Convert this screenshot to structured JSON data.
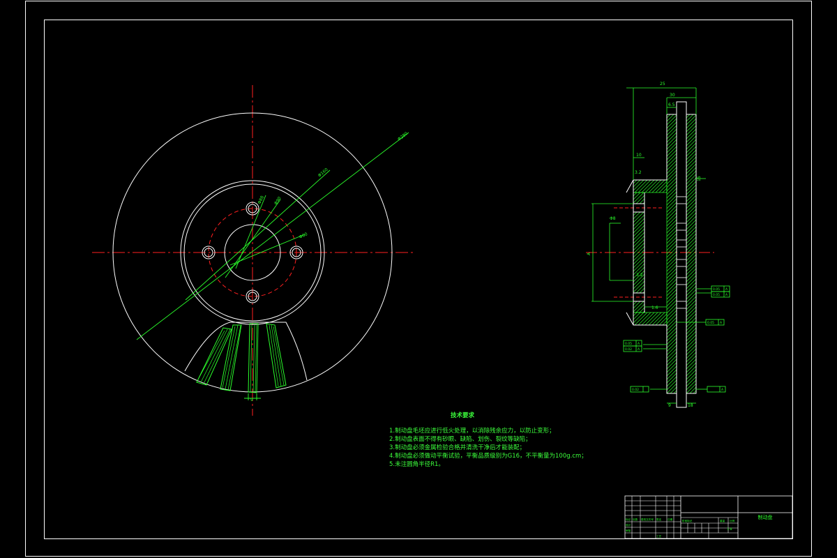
{
  "colors": {
    "background": "#000000",
    "frame": "#ffffff",
    "geometry": "#ffffff",
    "dimension": "#2bff2b",
    "centerline": "#ff2020",
    "hatch": "#2bff2b"
  },
  "front_view": {
    "dim_labels": [
      "Φ280",
      "Φ160",
      "Φ90",
      "Φ88",
      "Φ60",
      "9"
    ]
  },
  "section_view": {
    "dim_labels": [
      "25",
      "30",
      "6.5",
      "10",
      "3.2",
      "Φ8",
      "3.2",
      "1.6",
      "9",
      "18",
      "A",
      "15"
    ],
    "tolerance_tags": [
      "0.05",
      "0.05",
      "0.05",
      "0.05",
      "0.02",
      "0.02"
    ],
    "datum_tags": [
      "A",
      "A",
      "A",
      "A",
      "A",
      "A"
    ]
  },
  "technical_notes": {
    "title": "技术要求",
    "lines": [
      "1.制动盘毛坯应进行低火处理，以消除残余应力，以防止变形；",
      "2.制动盘表面不得有砂眼、缺陷、划伤、裂纹等缺陷；",
      "3.制动盘必须金属检验合格并清洗干净后才能装配；",
      "4.制动盘必须做动平衡试验，平衡品质级别为G16，不平衡量为100g.cm；",
      "5.未注圆角半径R1。"
    ]
  },
  "title_block": {
    "part_name": "制动盘",
    "scale": "1:8",
    "small_labels": [
      "标记",
      "处数",
      "更改文件号",
      "签名",
      "日期",
      "设计",
      "审核",
      "工艺",
      "阶段标记",
      "重量",
      "比例"
    ]
  }
}
